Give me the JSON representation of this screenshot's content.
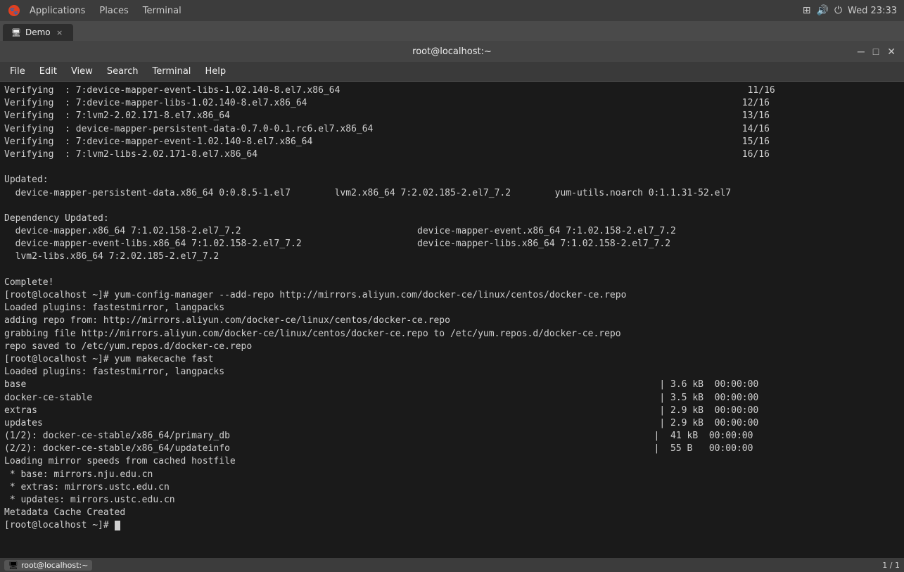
{
  "system_bar": {
    "apps_label": "Applications",
    "places_label": "Places",
    "terminal_label": "Terminal",
    "time": "Wed 23:33"
  },
  "tab": {
    "label": "Demo",
    "close": "×"
  },
  "terminal_title": "root@localhost:~",
  "menu": {
    "file": "File",
    "edit": "Edit",
    "view": "View",
    "search": "Search",
    "terminal": "Terminal",
    "help": "Help"
  },
  "terminal_output": [
    "Verifying  : 7:device-mapper-event-libs-1.02.140-8.el7.x86_64                                                                          11/16",
    "Verifying  : 7:device-mapper-libs-1.02.140-8.el7.x86_64                                                                               12/16",
    "Verifying  : 7:lvm2-2.02.171-8.el7.x86_64                                                                                             13/16",
    "Verifying  : device-mapper-persistent-data-0.7.0-0.1.rc6.el7.x86_64                                                                   14/16",
    "Verifying  : 7:device-mapper-event-1.02.140-8.el7.x86_64                                                                              15/16",
    "Verifying  : 7:lvm2-libs-2.02.171-8.el7.x86_64                                                                                        16/16",
    "",
    "Updated:",
    "  device-mapper-persistent-data.x86_64 0:0.8.5-1.el7        lvm2.x86_64 7:2.02.185-2.el7_7.2        yum-utils.noarch 0:1.1.31-52.el7",
    "",
    "Dependency Updated:",
    "  device-mapper.x86_64 7:1.02.158-2.el7_7.2                                device-mapper-event.x86_64 7:1.02.158-2.el7_7.2",
    "  device-mapper-event-libs.x86_64 7:1.02.158-2.el7_7.2                     device-mapper-libs.x86_64 7:1.02.158-2.el7_7.2",
    "  lvm2-libs.x86_64 7:2.02.185-2.el7_7.2",
    "",
    "Complete!",
    "[root@localhost ~]# yum-config-manager --add-repo http://mirrors.aliyun.com/docker-ce/linux/centos/docker-ce.repo",
    "Loaded plugins: fastestmirror, langpacks",
    "adding repo from: http://mirrors.aliyun.com/docker-ce/linux/centos/docker-ce.repo",
    "grabbing file http://mirrors.aliyun.com/docker-ce/linux/centos/docker-ce.repo to /etc/yum.repos.d/docker-ce.repo",
    "repo saved to /etc/yum.repos.d/docker-ce.repo",
    "[root@localhost ~]# yum makecache fast",
    "Loaded plugins: fastestmirror, langpacks",
    "base                                                                                                                   | 3.6 kB  00:00:00",
    "docker-ce-stable                                                                                                       | 3.5 kB  00:00:00",
    "extras                                                                                                                 | 2.9 kB  00:00:00",
    "updates                                                                                                                | 2.9 kB  00:00:00",
    "(1/2): docker-ce-stable/x86_64/primary_db                                                                             |  41 kB  00:00:00",
    "(2/2): docker-ce-stable/x86_64/updateinfo                                                                             |  55 B   00:00:00",
    "Loading mirror speeds from cached hostfile",
    " * base: mirrors.nju.edu.cn",
    " * extras: mirrors.ustc.edu.cn",
    " * updates: mirrors.ustc.edu.cn",
    "Metadata Cache Created",
    "[root@localhost ~]# "
  ],
  "bottom_bar": {
    "taskbar_icon": "🖥",
    "taskbar_label": "root@localhost:~",
    "page_info": "1 / 1"
  },
  "win_buttons": {
    "minimize": "─",
    "maximize": "□",
    "close": "✕"
  }
}
